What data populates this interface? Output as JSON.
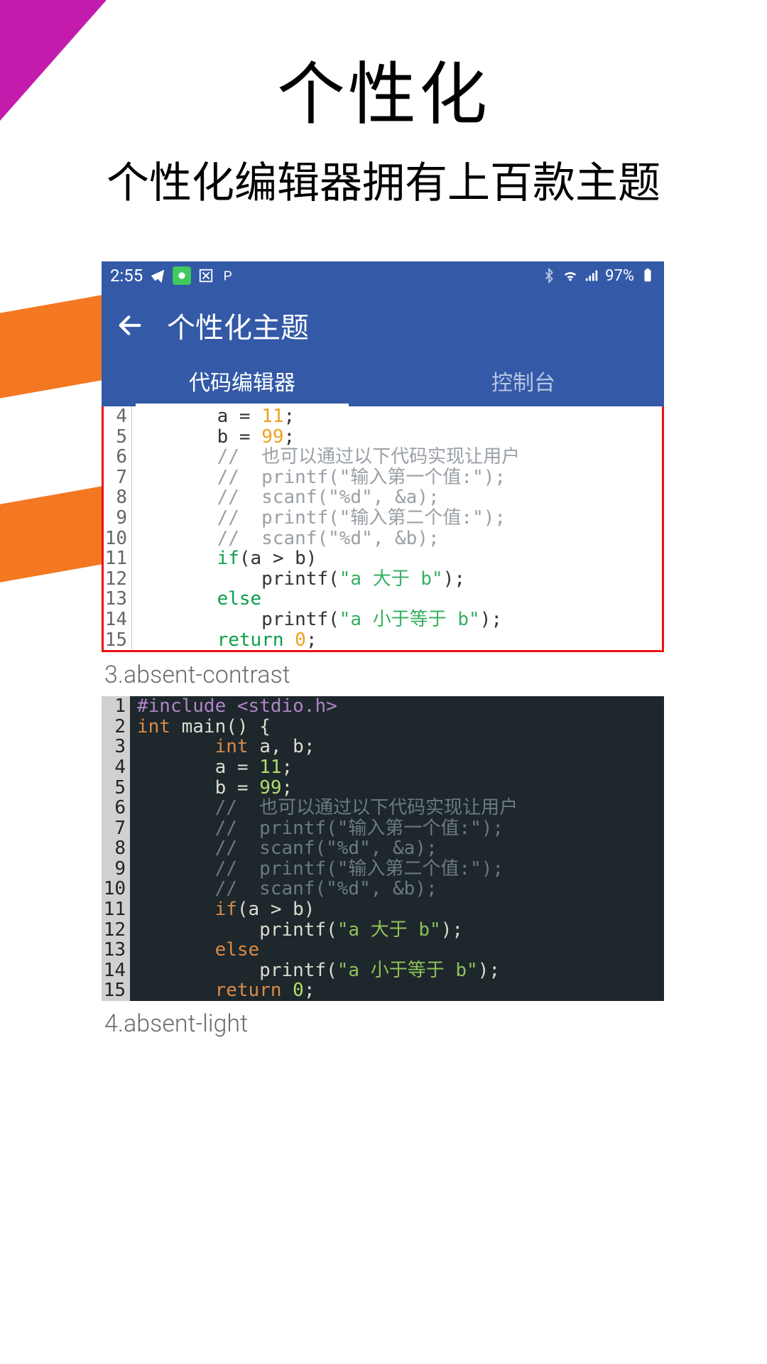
{
  "hero": {
    "title": "个性化",
    "subtitle": "个性化编辑器拥有上百款主题"
  },
  "statusbar": {
    "time": "2:55",
    "battery": "97%"
  },
  "appbar": {
    "title": "个性化主题",
    "tabs": {
      "editor": "代码编辑器",
      "console": "控制台"
    }
  },
  "lightCode": {
    "lines": [
      {
        "n": "4"
      },
      {
        "n": "5"
      },
      {
        "n": "6"
      },
      {
        "n": "7"
      },
      {
        "n": "8"
      },
      {
        "n": "9"
      },
      {
        "n": "10"
      },
      {
        "n": "11"
      },
      {
        "n": "12"
      },
      {
        "n": "13"
      },
      {
        "n": "14"
      },
      {
        "n": "15"
      }
    ],
    "l4a": "       a = ",
    "l4v": "11",
    "l5a": "       b = ",
    "l5v": "99",
    "l6": "       //  也可以通过以下代码实现让用户",
    "l7": "       //  printf(\"输入第一个值:\");",
    "l8": "       //  scanf(\"%d\", &a);",
    "l9": "       //  printf(\"输入第二个值:\");",
    "l10": "       //  scanf(\"%d\", &b);",
    "l11k": "if",
    "l11r": "(a > b)",
    "l12a": "           printf(",
    "l12s": "\"a 大于 b\"",
    "l12e": ");",
    "l13": "else",
    "l14a": "           printf(",
    "l14s": "\"a 小于等于 b\"",
    "l14e": ");",
    "l15a": "return ",
    "l15n": "0",
    "l15e": ";"
  },
  "theme3": "3.absent-contrast",
  "darkCode": {
    "l1a": "#include ",
    "l1b": "<stdio.h>",
    "l2a": "int",
    "l2b": " main() {",
    "l3a": "       ",
    "l3t": "int",
    "l3b": " a, b;",
    "l4a": "       a = ",
    "l4v": "11",
    "l5a": "       b = ",
    "l5v": "99",
    "l6": "       //  也可以通过以下代码实现让用户",
    "l7": "       //  printf(\"输入第一个值:\");",
    "l8": "       //  scanf(\"%d\", &a);",
    "l9": "       //  printf(\"输入第二个值:\");",
    "l10": "       //  scanf(\"%d\", &b);",
    "l11k": "if",
    "l11r": "(a > b)",
    "l12a": "           printf(",
    "l12s": "\"a 大于 b\"",
    "l12e": ");",
    "l13": "else",
    "l14a": "           printf(",
    "l14s": "\"a 小于等于 b\"",
    "l14e": ");",
    "l15a": "return ",
    "l15n": "0",
    "l15e": ";",
    "lines": [
      "1",
      "2",
      "3",
      "4",
      "5",
      "6",
      "7",
      "8",
      "9",
      "10",
      "11",
      "12",
      "13",
      "14",
      "15"
    ]
  },
  "theme4": "4.absent-light"
}
